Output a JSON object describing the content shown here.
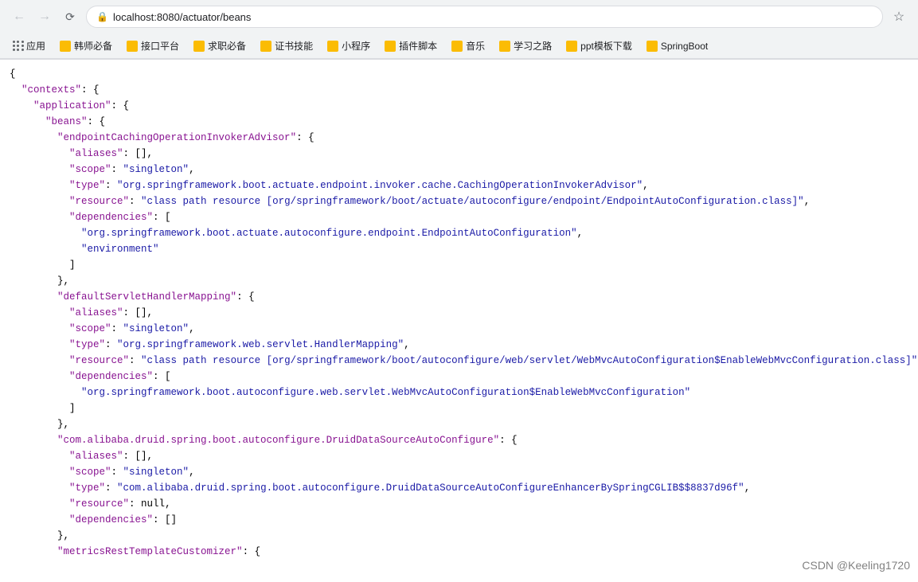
{
  "browser": {
    "url": "localhost:8080/actuator/beans",
    "back_disabled": true,
    "forward_disabled": true
  },
  "bookmarks": [
    {
      "label": "应用",
      "color": "#4285f4"
    },
    {
      "label": "韩师必备",
      "color": "#fbbc04"
    },
    {
      "label": "接口平台",
      "color": "#fbbc04"
    },
    {
      "label": "求职必备",
      "color": "#fbbc04"
    },
    {
      "label": "证书技能",
      "color": "#fbbc04"
    },
    {
      "label": "小程序",
      "color": "#fbbc04"
    },
    {
      "label": "插件脚本",
      "color": "#fbbc04"
    },
    {
      "label": "音乐",
      "color": "#fbbc04"
    },
    {
      "label": "学习之路",
      "color": "#fbbc04"
    },
    {
      "label": "ppt模板下载",
      "color": "#fbbc04"
    },
    {
      "label": "SpringBoot",
      "color": "#fbbc04"
    }
  ],
  "watermark": "CSDN @Keeling1720"
}
